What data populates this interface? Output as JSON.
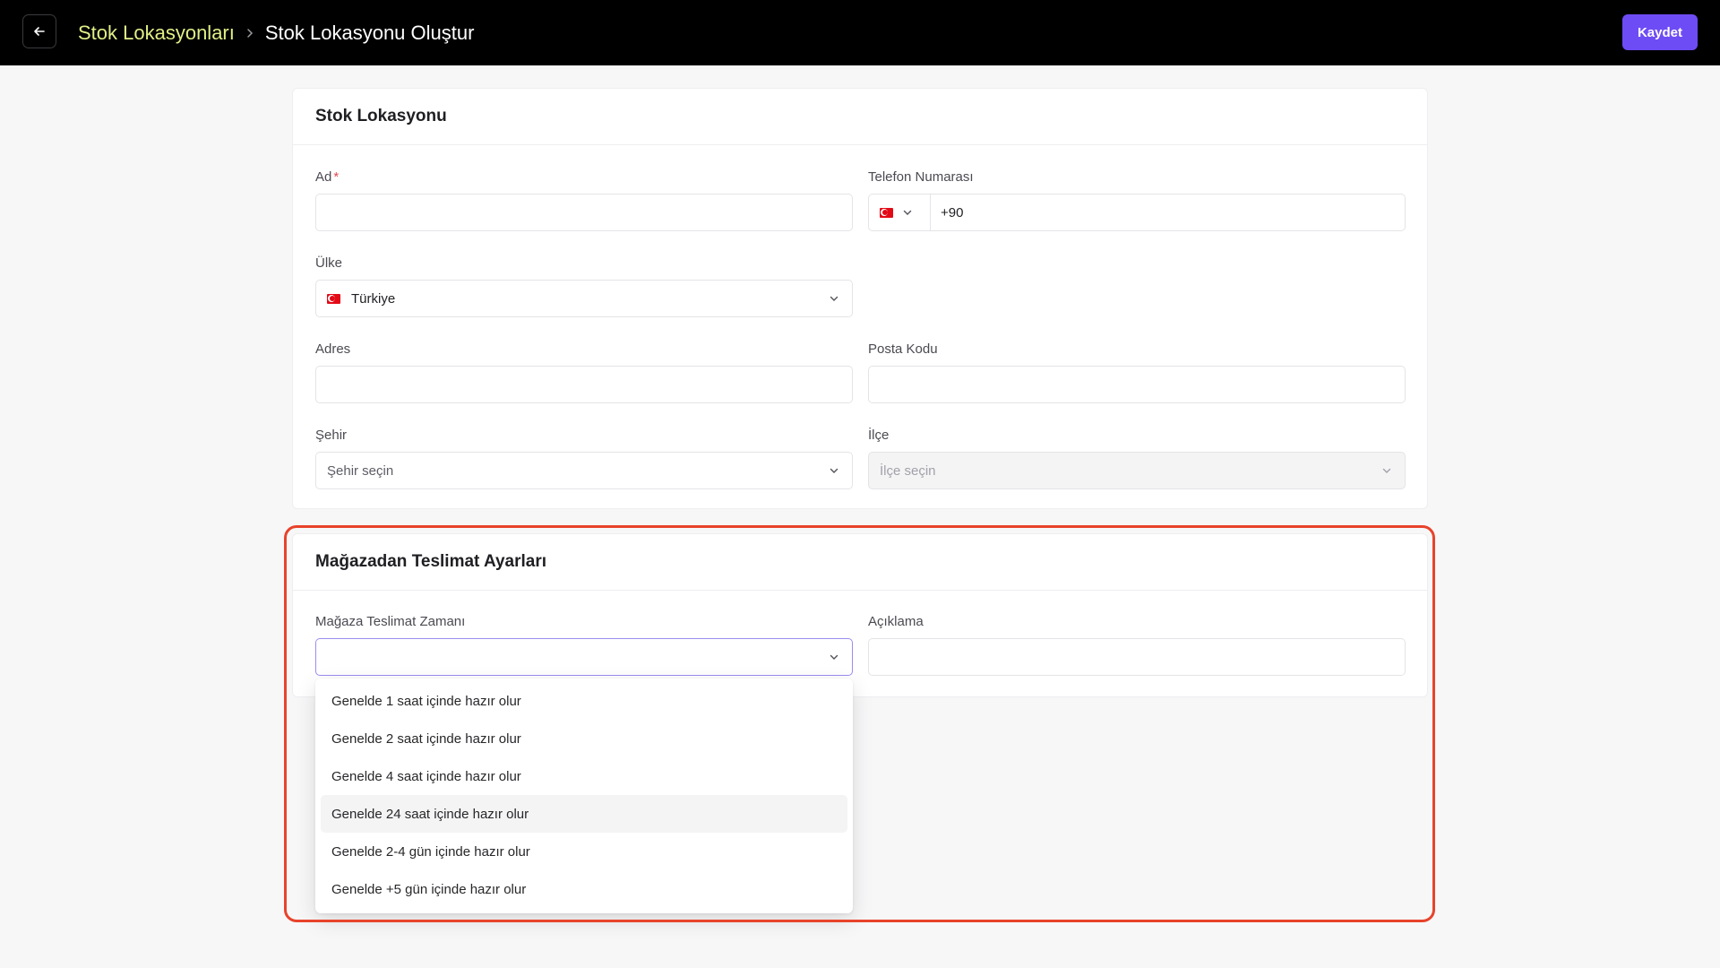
{
  "header": {
    "breadcrumb_parent": "Stok Lokasyonları",
    "breadcrumb_current": "Stok Lokasyonu Oluştur",
    "save_label": "Kaydet",
    "accent": "#6e4cf5",
    "breadcrumb_color": "#e2ef86"
  },
  "location_card": {
    "title": "Stok Lokasyonu",
    "name_label": "Ad",
    "name_required": "*",
    "name_value": "",
    "phone_label": "Telefon Numarası",
    "phone_country_icon": "turkey-flag-icon",
    "phone_value": "+90",
    "country_label": "Ülke",
    "country_value": "Türkiye",
    "address_label": "Adres",
    "address_value": "",
    "postal_label": "Posta Kodu",
    "postal_value": "",
    "city_label": "Şehir",
    "city_placeholder": "Şehir seçin",
    "district_label": "İlçe",
    "district_placeholder": "İlçe seçin"
  },
  "pickup_card": {
    "title": "Mağazadan Teslimat Ayarları",
    "time_label": "Mağaza Teslimat Zamanı",
    "time_value": "",
    "description_label": "Açıklama",
    "description_value": "",
    "time_options": [
      "Genelde 1 saat içinde hazır olur",
      "Genelde 2 saat içinde hazır olur",
      "Genelde 4 saat içinde hazır olur",
      "Genelde 24 saat içinde hazır olur",
      "Genelde 2-4 gün içinde hazır olur",
      "Genelde +5 gün içinde hazır olur"
    ],
    "hovered_option": "Genelde 24 saat içinde hazır olur",
    "highlight_color": "#e8432b"
  }
}
